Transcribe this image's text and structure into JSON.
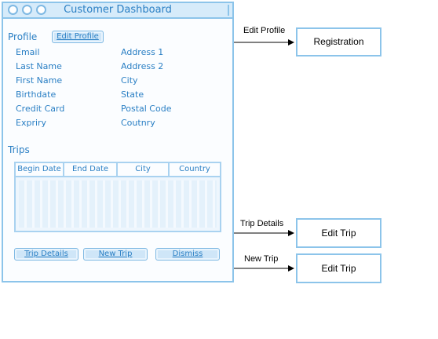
{
  "window": {
    "title": "Customer Dashboard"
  },
  "profile": {
    "section_label": "Profile",
    "edit_button": "Edit Profile",
    "fields_left": [
      "Email",
      "Last Name",
      "First Name",
      "Birthdate",
      "Credit Card",
      "Exprirу"
    ],
    "fields_right": [
      "Address 1",
      "Address 2",
      "City",
      "State",
      "Postal Code",
      "Coutnry"
    ]
  },
  "trips": {
    "section_label": "Trips",
    "columns": [
      "Begin Date",
      "End Date",
      "City",
      "Country"
    ]
  },
  "buttons": {
    "trip_details": "Trip Details",
    "new_trip": "New Trip",
    "dismiss": "Dismiss"
  },
  "flows": [
    {
      "label": "Edit Profile",
      "target": "Registration"
    },
    {
      "label": "Trip Details",
      "target": "Edit Trip"
    },
    {
      "label": "New Trip",
      "target": "Edit Trip"
    }
  ]
}
